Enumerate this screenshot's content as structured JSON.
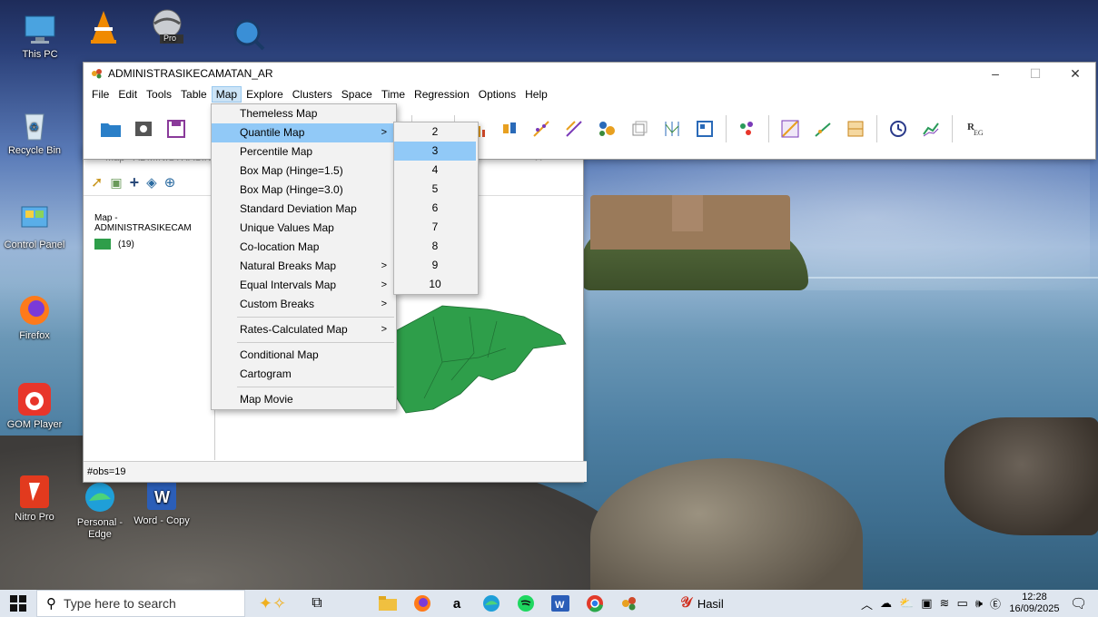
{
  "desktop": {
    "icons": [
      {
        "label": "This PC"
      },
      {
        "label": "Recycle Bin"
      },
      {
        "label": "Control Panel"
      },
      {
        "label": "Firefox"
      },
      {
        "label": "GOM Player"
      },
      {
        "label": "Nitro Pro"
      },
      {
        "label": "Personal - Edge"
      },
      {
        "label": "Word - Copy"
      },
      {
        "label": "Pro"
      }
    ]
  },
  "app": {
    "title": "ADMINISTRASIKECAMATAN_AR",
    "menu": [
      "File",
      "Edit",
      "Tools",
      "Table",
      "Map",
      "Explore",
      "Clusters",
      "Space",
      "Time",
      "Regression",
      "Options",
      "Help"
    ],
    "window_controls": [
      "–",
      "☐",
      "✕"
    ]
  },
  "map_window": {
    "title": "Map - ADMINISTRASIK",
    "legend_title": "Map - ADMINISTRASIKECAM",
    "legend_count": "(19)",
    "status": "#obs=19",
    "fill_color": "#2e9e4a"
  },
  "map_menu": {
    "items": [
      {
        "label": "Themeless Map"
      },
      {
        "label": "Quantile Map",
        "submenu": true
      },
      {
        "label": "Percentile Map"
      },
      {
        "label": "Box Map (Hinge=1.5)"
      },
      {
        "label": "Box Map (Hinge=3.0)"
      },
      {
        "label": "Standard Deviation Map"
      },
      {
        "label": "Unique Values Map"
      },
      {
        "label": "Co-location Map"
      },
      {
        "label": "Natural Breaks Map",
        "submenu": true
      },
      {
        "label": "Equal Intervals Map",
        "submenu": true
      },
      {
        "label": "Custom Breaks",
        "submenu": true
      },
      {
        "label": "Rates-Calculated Map",
        "submenu": true
      },
      {
        "label": "Conditional Map"
      },
      {
        "label": "Cartogram"
      },
      {
        "label": "Map Movie"
      }
    ],
    "arrow": ">"
  },
  "quantile_submenu": [
    "2",
    "3",
    "4",
    "5",
    "6",
    "7",
    "8",
    "9",
    "10"
  ],
  "taskbar": {
    "search_placeholder": "Type here to search",
    "pinned_label": "Hasil",
    "time": "12:28",
    "date": "16/09/2025"
  }
}
